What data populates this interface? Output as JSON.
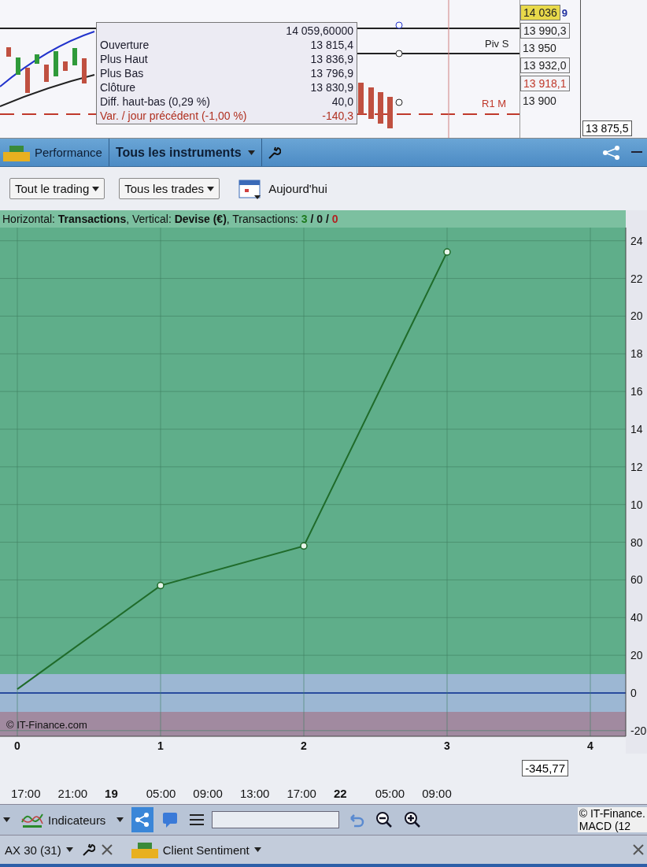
{
  "top_chart": {
    "tooltip": {
      "header_value": "14 059,60000",
      "rows": [
        {
          "label": "Ouverture",
          "value": "13 815,4",
          "kind": "normal"
        },
        {
          "label": "Plus Haut",
          "value": "13 836,9",
          "kind": "normal"
        },
        {
          "label": "Plus Bas",
          "value": "13 796,9",
          "kind": "normal"
        },
        {
          "label": "Clôture",
          "value": "13 830,9",
          "kind": "normal"
        },
        {
          "label": "Diff. haut-bas (0,29 %)",
          "value": "40,0",
          "kind": "normal"
        },
        {
          "label": "Var. / jour précédent (-1,00 %)",
          "value": "-140,3",
          "kind": "negative"
        }
      ]
    },
    "line_labels": [
      "Piv S",
      "R1 M"
    ],
    "price_tags": [
      {
        "text": "14 036",
        "kind": "current"
      },
      {
        "text": "13 990,3",
        "kind": "level"
      },
      {
        "text": "13 950",
        "kind": "tick"
      },
      {
        "text": "13 932,0",
        "kind": "level"
      },
      {
        "text": "13 918,1",
        "kind": "resistance"
      },
      {
        "text": "13 900",
        "kind": "tick"
      }
    ],
    "side_badge": "9",
    "right_tag": "13 875,5"
  },
  "panel": {
    "title": "Performance",
    "instrument_menu": "Tous les instruments"
  },
  "filters": [
    {
      "label": "Tout le trading"
    },
    {
      "label": "Tous les trades"
    }
  ],
  "date_label": "Aujourd'hui",
  "chart_header": {
    "parts": [
      "Horizontal: ",
      "Transactions",
      ", Vertical: ",
      "Devise (€)",
      ", Transactions: "
    ],
    "counts": [
      {
        "text": "3",
        "color": "#1e7a1e"
      },
      {
        "text": "0",
        "color": "#1a1a1a"
      },
      {
        "text": "0",
        "color": "#b22222"
      }
    ],
    "separators": [
      "/",
      "/"
    ]
  },
  "copyright": "© IT-Finance.com",
  "y_axis_cut_labels": [
    "24",
    "22",
    "20",
    "18",
    "16",
    "14",
    "12",
    "10"
  ],
  "chart_data": {
    "type": "line",
    "categories": [
      "0",
      "1",
      "2",
      "3",
      "4"
    ],
    "series": [
      {
        "color": "#1f6b2a",
        "values": [
          2,
          57,
          78,
          234,
          null
        ]
      }
    ],
    "ylim": [
      -23,
      247
    ],
    "yticks": [
      80,
      60,
      40,
      20,
      0,
      -20
    ],
    "grid": true
  },
  "bottom": {
    "value_tag": "-345,77",
    "times": [
      {
        "text": "17:00",
        "kind": "time"
      },
      {
        "text": "21:00",
        "kind": "time"
      },
      {
        "text": "19",
        "kind": "day"
      },
      {
        "text": "05:00",
        "kind": "time"
      },
      {
        "text": "09:00",
        "kind": "time"
      },
      {
        "text": "13:00",
        "kind": "time"
      },
      {
        "text": "17:00",
        "kind": "time"
      },
      {
        "text": "22",
        "kind": "day"
      },
      {
        "text": "05:00",
        "kind": "time"
      },
      {
        "text": "09:00",
        "kind": "time"
      }
    ],
    "indicators_button": "Indicateurs",
    "right_copyright": "© IT-Finance.",
    "macd_label": "MACD (12",
    "list_panel": "AX 30 (31)",
    "sentiment_panel": "Client Sentiment"
  }
}
